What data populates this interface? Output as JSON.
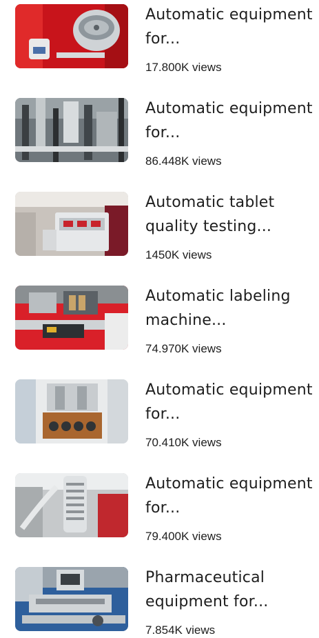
{
  "videos": [
    {
      "title": "Automatic equipment for...",
      "views": "17.800K views",
      "thumbnail_icon": "stainless-bowl-machine-thumbnail"
    },
    {
      "title": "Automatic equipment for...",
      "views": "86.448K views",
      "thumbnail_icon": "filling-line-machine-thumbnail"
    },
    {
      "title": "Automatic tablet quality testing...",
      "views": "1450K views",
      "thumbnail_icon": "tablet-tester-thumbnail"
    },
    {
      "title": "Automatic labeling machine...",
      "views": "74.970K views",
      "thumbnail_icon": "labeling-machine-thumbnail"
    },
    {
      "title": "Automatic equipment for...",
      "views": "70.410K views",
      "thumbnail_icon": "tablet-press-thumbnail"
    },
    {
      "title": "Automatic equipment for...",
      "views": "79.400K views",
      "thumbnail_icon": "coil-conveyor-thumbnail"
    },
    {
      "title": "Pharmaceutical equipment for...",
      "views": "7.854K views",
      "thumbnail_icon": "pharmaceutical-line-thumbnail"
    }
  ]
}
